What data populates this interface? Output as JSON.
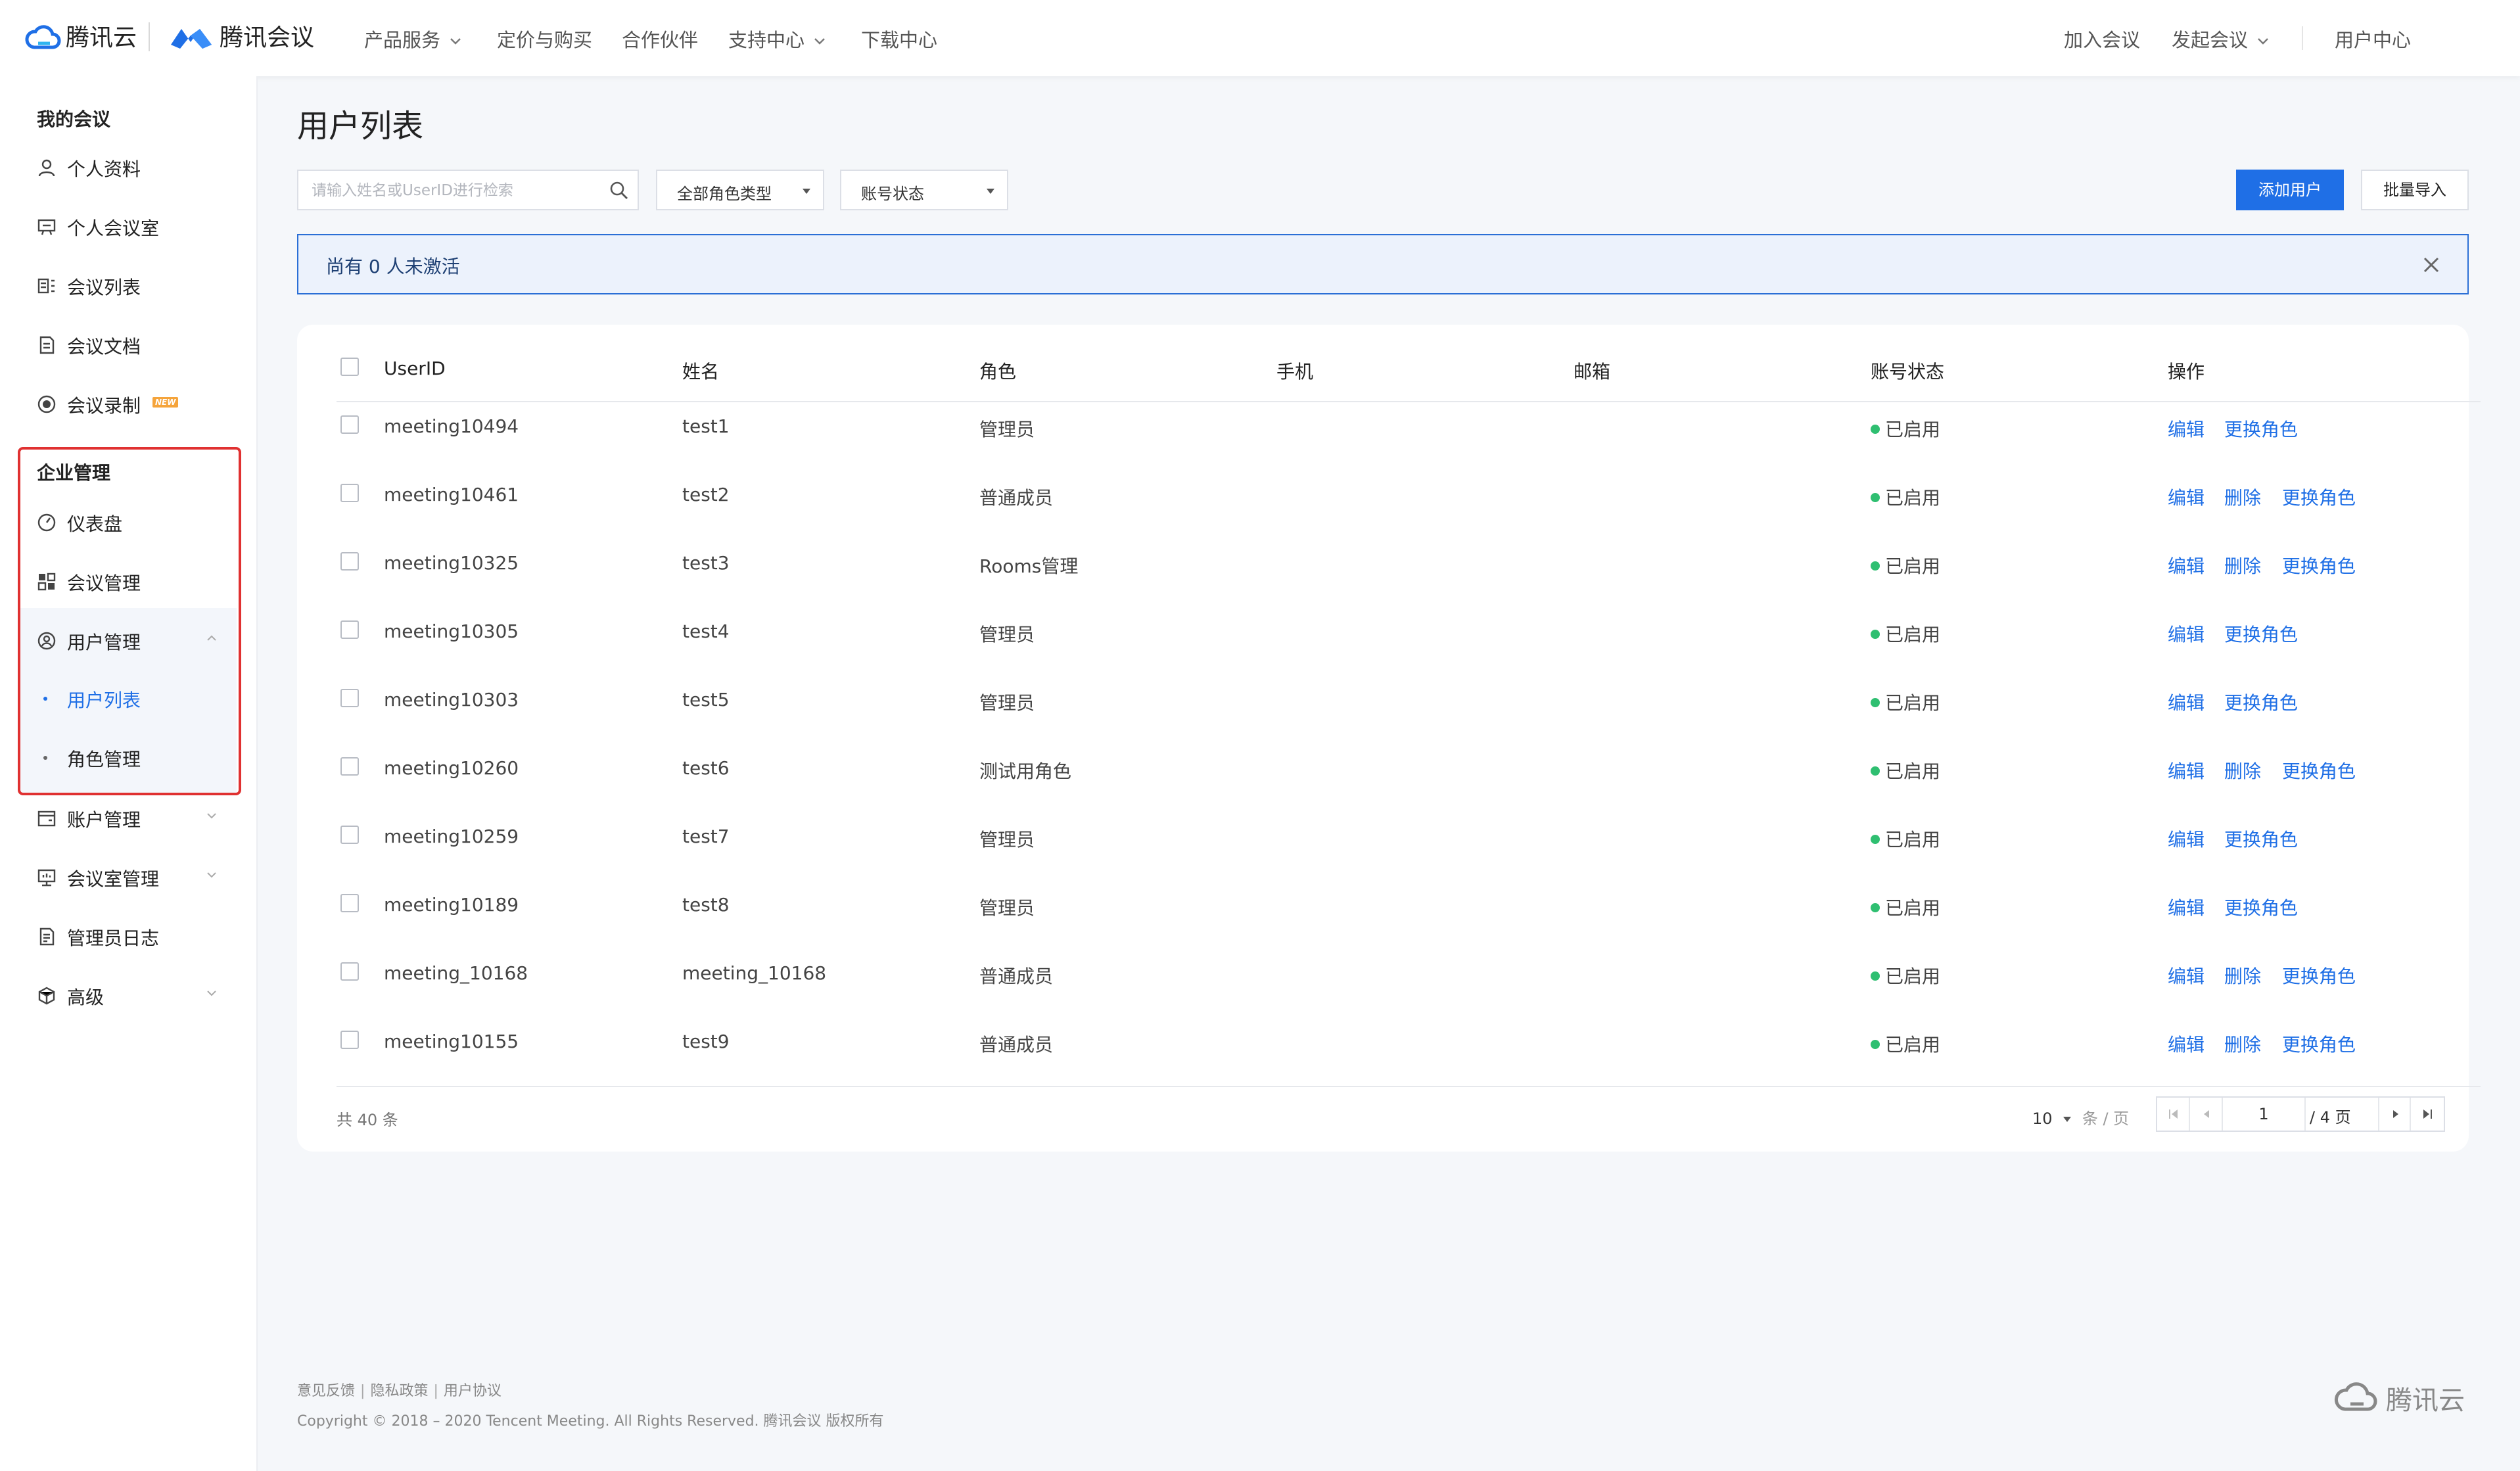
{
  "brand": {
    "cloud_name": "腾讯云",
    "product_name": "腾讯会议"
  },
  "topnav": {
    "items": [
      {
        "label": "产品服务",
        "dropdown": true
      },
      {
        "label": "定价与购买",
        "dropdown": false
      },
      {
        "label": "合作伙伴",
        "dropdown": false
      },
      {
        "label": "支持中心",
        "dropdown": true
      },
      {
        "label": "下载中心",
        "dropdown": false
      }
    ],
    "join_meeting": "加入会议",
    "start_meeting": "发起会议",
    "user_center": "用户中心"
  },
  "sidebar": {
    "my_meetings_title": "我的会议",
    "my_items": [
      {
        "label": "个人资料",
        "icon": "person-icon"
      },
      {
        "label": "个人会议室",
        "icon": "meeting-room-icon"
      },
      {
        "label": "会议列表",
        "icon": "list-icon"
      },
      {
        "label": "会议文档",
        "icon": "document-icon"
      },
      {
        "label": "会议录制",
        "icon": "record-icon",
        "badge": "NEW"
      }
    ],
    "enterprise_title": "企业管理",
    "enterprise_items": [
      {
        "label": "仪表盘",
        "icon": "dashboard-icon"
      },
      {
        "label": "会议管理",
        "icon": "grid-icon"
      },
      {
        "label": "用户管理",
        "icon": "user-circle-icon",
        "expanded": true
      }
    ],
    "user_mgmt_sub": [
      {
        "label": "用户列表",
        "active": true
      },
      {
        "label": "角色管理",
        "active": false
      }
    ],
    "more_items": [
      {
        "label": "账户管理",
        "icon": "wallet-icon",
        "collapsible": true
      },
      {
        "label": "会议室管理",
        "icon": "monitor-icon",
        "collapsible": true
      },
      {
        "label": "管理员日志",
        "icon": "log-icon",
        "collapsible": false
      },
      {
        "label": "高级",
        "icon": "cube-icon",
        "collapsible": true
      }
    ]
  },
  "main": {
    "title": "用户列表",
    "search_placeholder": "请输入姓名或UserID进行检索",
    "role_filter": "全部角色类型",
    "status_filter": "账号状态",
    "add_user": "添加用户",
    "batch_import": "批量导入",
    "notice": "尚有 0 人未激活"
  },
  "table": {
    "columns": [
      "UserID",
      "姓名",
      "角色",
      "手机",
      "邮箱",
      "账号状态",
      "操作"
    ],
    "rows": [
      {
        "userid": "meeting10494",
        "name": "test1",
        "role": "管理员",
        "phone": "",
        "email": "",
        "status": "已启用",
        "actions": [
          "编辑",
          "更换角色"
        ]
      },
      {
        "userid": "meeting10461",
        "name": "test2",
        "role": "普通成员",
        "phone": "",
        "email": "",
        "status": "已启用",
        "actions": [
          "编辑",
          "删除",
          "更换角色"
        ]
      },
      {
        "userid": "meeting10325",
        "name": "test3",
        "role": "Rooms管理",
        "phone": "",
        "email": "",
        "status": "已启用",
        "actions": [
          "编辑",
          "删除",
          "更换角色"
        ]
      },
      {
        "userid": "meeting10305",
        "name": "test4",
        "role": "管理员",
        "phone": "",
        "email": "",
        "status": "已启用",
        "actions": [
          "编辑",
          "更换角色"
        ]
      },
      {
        "userid": "meeting10303",
        "name": "test5",
        "role": "管理员",
        "phone": "",
        "email": "",
        "status": "已启用",
        "actions": [
          "编辑",
          "更换角色"
        ]
      },
      {
        "userid": "meeting10260",
        "name": "test6",
        "role": "测试用角色",
        "phone": "",
        "email": "",
        "status": "已启用",
        "actions": [
          "编辑",
          "删除",
          "更换角色"
        ]
      },
      {
        "userid": "meeting10259",
        "name": "test7",
        "role": "管理员",
        "phone": "",
        "email": "",
        "status": "已启用",
        "actions": [
          "编辑",
          "更换角色"
        ]
      },
      {
        "userid": "meeting10189",
        "name": "test8",
        "role": "管理员",
        "phone": "",
        "email": "",
        "status": "已启用",
        "actions": [
          "编辑",
          "更换角色"
        ]
      },
      {
        "userid": "meeting_10168",
        "name": "meeting_10168",
        "role": "普通成员",
        "phone": "",
        "email": "",
        "status": "已启用",
        "actions": [
          "编辑",
          "删除",
          "更换角色"
        ]
      },
      {
        "userid": "meeting10155",
        "name": "test9",
        "role": "普通成员",
        "phone": "",
        "email": "",
        "status": "已启用",
        "actions": [
          "编辑",
          "删除",
          "更换角色"
        ]
      }
    ],
    "total_text": "共 40 条",
    "page_size": "10",
    "page_size_unit": "条 / 页",
    "current_page": "1",
    "total_pages_text": "/ 4 页"
  },
  "footer": {
    "links": [
      "意见反馈",
      "隐私政策",
      "用户协议"
    ],
    "copyright": "Copyright © 2018 – 2020 Tencent Meeting. All Rights Reserved. 腾讯会议 版权所有",
    "logo_text": "腾讯云"
  },
  "colors": {
    "accent": "#1f6fe6",
    "status_green": "#2fbf71",
    "highlight_red": "#e03131",
    "notice_bg": "#ecf2fc"
  }
}
